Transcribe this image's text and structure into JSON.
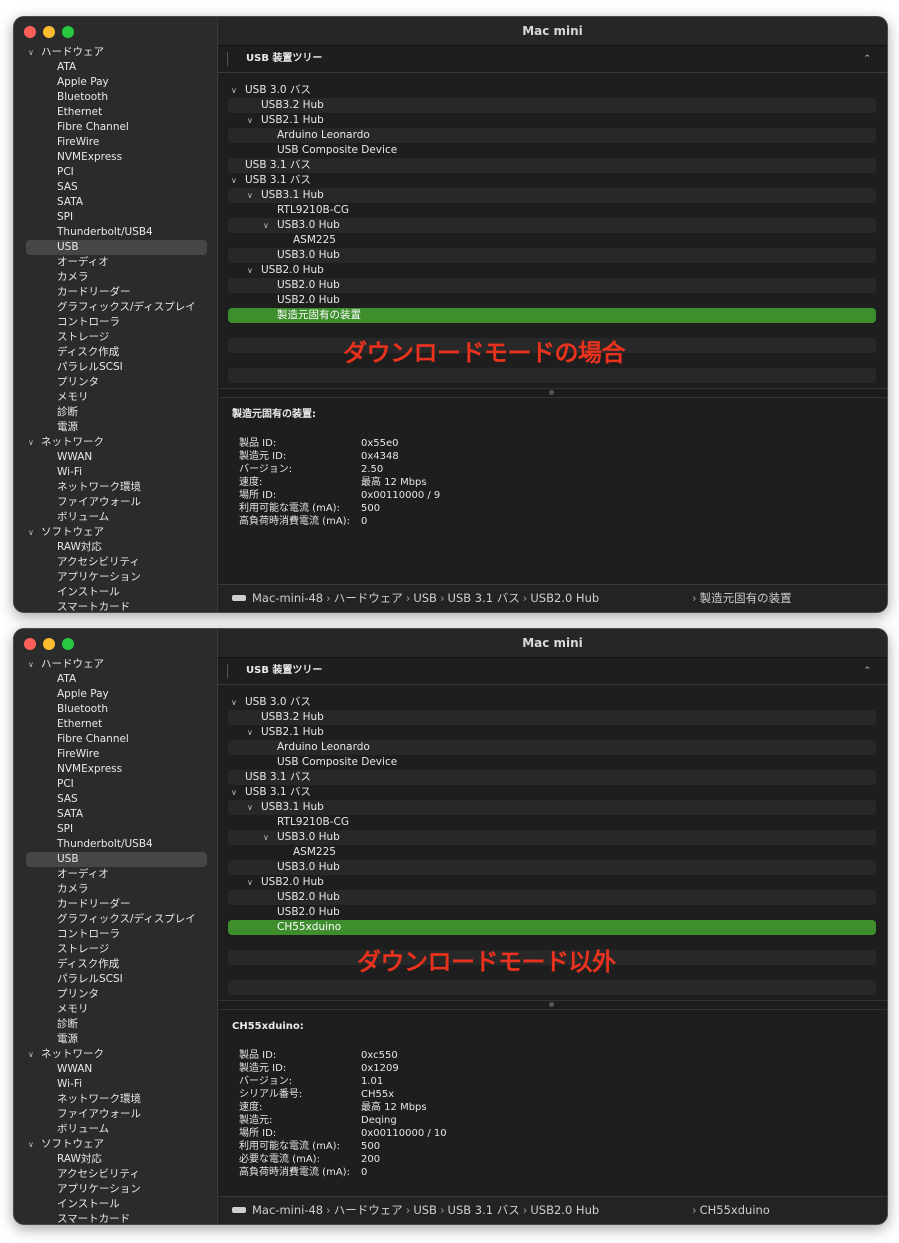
{
  "window_title": "Mac mini",
  "sidebar": [
    {
      "label": "ハードウェア",
      "type": "section"
    },
    {
      "label": "ATA",
      "type": "sub"
    },
    {
      "label": "Apple Pay",
      "type": "sub"
    },
    {
      "label": "Bluetooth",
      "type": "sub"
    },
    {
      "label": "Ethernet",
      "type": "sub"
    },
    {
      "label": "Fibre Channel",
      "type": "sub"
    },
    {
      "label": "FireWire",
      "type": "sub"
    },
    {
      "label": "NVMExpress",
      "type": "sub"
    },
    {
      "label": "PCI",
      "type": "sub"
    },
    {
      "label": "SAS",
      "type": "sub"
    },
    {
      "label": "SATA",
      "type": "sub"
    },
    {
      "label": "SPI",
      "type": "sub"
    },
    {
      "label": "Thunderbolt/USB4",
      "type": "sub"
    },
    {
      "label": "USB",
      "type": "sub",
      "selected": true
    },
    {
      "label": "オーディオ",
      "type": "sub"
    },
    {
      "label": "カメラ",
      "type": "sub"
    },
    {
      "label": "カードリーダー",
      "type": "sub"
    },
    {
      "label": "グラフィックス/ディスプレイ",
      "type": "sub"
    },
    {
      "label": "コントローラ",
      "type": "sub"
    },
    {
      "label": "ストレージ",
      "type": "sub"
    },
    {
      "label": "ディスク作成",
      "type": "sub"
    },
    {
      "label": "パラレルSCSI",
      "type": "sub"
    },
    {
      "label": "プリンタ",
      "type": "sub"
    },
    {
      "label": "メモリ",
      "type": "sub"
    },
    {
      "label": "診断",
      "type": "sub"
    },
    {
      "label": "電源",
      "type": "sub"
    },
    {
      "label": "ネットワーク",
      "type": "section"
    },
    {
      "label": "WWAN",
      "type": "sub"
    },
    {
      "label": "Wi-Fi",
      "type": "sub"
    },
    {
      "label": "ネットワーク環境",
      "type": "sub"
    },
    {
      "label": "ファイアウォール",
      "type": "sub"
    },
    {
      "label": "ボリューム",
      "type": "sub"
    },
    {
      "label": "ソフトウェア",
      "type": "section"
    },
    {
      "label": "RAW対応",
      "type": "sub"
    },
    {
      "label": "アクセシビリティ",
      "type": "sub"
    },
    {
      "label": "アプリケーション",
      "type": "sub"
    },
    {
      "label": "インストール",
      "type": "sub"
    },
    {
      "label": "スマートカード",
      "type": "sub"
    }
  ],
  "tree_header": "USB 装置ツリー",
  "tree_common": [
    {
      "label": "USB 3.0 バス",
      "level": 0,
      "chevron": true
    },
    {
      "label": "USB3.2 Hub",
      "level": 1,
      "chevron": false
    },
    {
      "label": "USB2.1 Hub",
      "level": 1,
      "chevron": true
    },
    {
      "label": "Arduino Leonardo",
      "level": 2,
      "chevron": false
    },
    {
      "label": "USB Composite Device",
      "level": 2,
      "chevron": false
    },
    {
      "label": "USB 3.1 バス",
      "level": 0,
      "chevron": false
    },
    {
      "label": "USB 3.1 バス",
      "level": 0,
      "chevron": true
    },
    {
      "label": "USB3.1 Hub",
      "level": 1,
      "chevron": true
    },
    {
      "label": "RTL9210B-CG",
      "level": 2,
      "chevron": false
    },
    {
      "label": "USB3.0 Hub",
      "level": 2,
      "chevron": true
    },
    {
      "label": "ASM225",
      "level": 3,
      "chevron": false
    },
    {
      "label": "USB3.0 Hub",
      "level": 2,
      "chevron": false
    },
    {
      "label": "USB2.0 Hub",
      "level": 1,
      "chevron": true
    },
    {
      "label": "USB2.0 Hub",
      "level": 2,
      "chevron": false
    },
    {
      "label": "USB2.0 Hub",
      "level": 2,
      "chevron": false
    }
  ],
  "icons": {
    "chevron": "chevron-down-icon",
    "caret": "chevron-up-icon",
    "disk": "disk-icon"
  },
  "colors": {
    "selection": "#3e8e2e",
    "overlay": "#e8321e"
  },
  "breadcrumb_common": [
    "Mac-mini-48",
    "ハードウェア",
    "USB",
    "USB 3.1 バス",
    "USB2.0 Hub"
  ],
  "windows": [
    {
      "selected_device": "製造元固有の装置",
      "overlay_text": "ダウンロードモードの場合",
      "detail_title": "製造元固有の装置:",
      "details": [
        {
          "k": "製品 ID:",
          "v": "0x55e0"
        },
        {
          "k": "製造元 ID:",
          "v": "0x4348"
        },
        {
          "k": "バージョン:",
          "v": "2.50"
        },
        {
          "k": "速度:",
          "v": "最高 12 Mbps"
        },
        {
          "k": "場所 ID:",
          "v": "0x00110000 / 9"
        },
        {
          "k": "利用可能な電流 (mA):",
          "v": "500"
        },
        {
          "k": "高負荷時消費電流 (mA):",
          "v": "0"
        }
      ],
      "breadcrumb_last": "製造元固有の装置"
    },
    {
      "selected_device": "CH55xduino",
      "overlay_text": "ダウンロードモード以外",
      "detail_title": "CH55xduino:",
      "details": [
        {
          "k": "製品 ID:",
          "v": "0xc550"
        },
        {
          "k": "製造元 ID:",
          "v": "0x1209"
        },
        {
          "k": "バージョン:",
          "v": "1.01"
        },
        {
          "k": "シリアル番号:",
          "v": "CH55x"
        },
        {
          "k": "速度:",
          "v": "最高 12 Mbps"
        },
        {
          "k": "製造元:",
          "v": "Deqing"
        },
        {
          "k": "場所 ID:",
          "v": "0x00110000 / 10"
        },
        {
          "k": "利用可能な電流 (mA):",
          "v": "500"
        },
        {
          "k": "必要な電流 (mA):",
          "v": "200"
        },
        {
          "k": "高負荷時消費電流 (mA):",
          "v": "0"
        }
      ],
      "breadcrumb_last": "CH55xduino"
    }
  ]
}
